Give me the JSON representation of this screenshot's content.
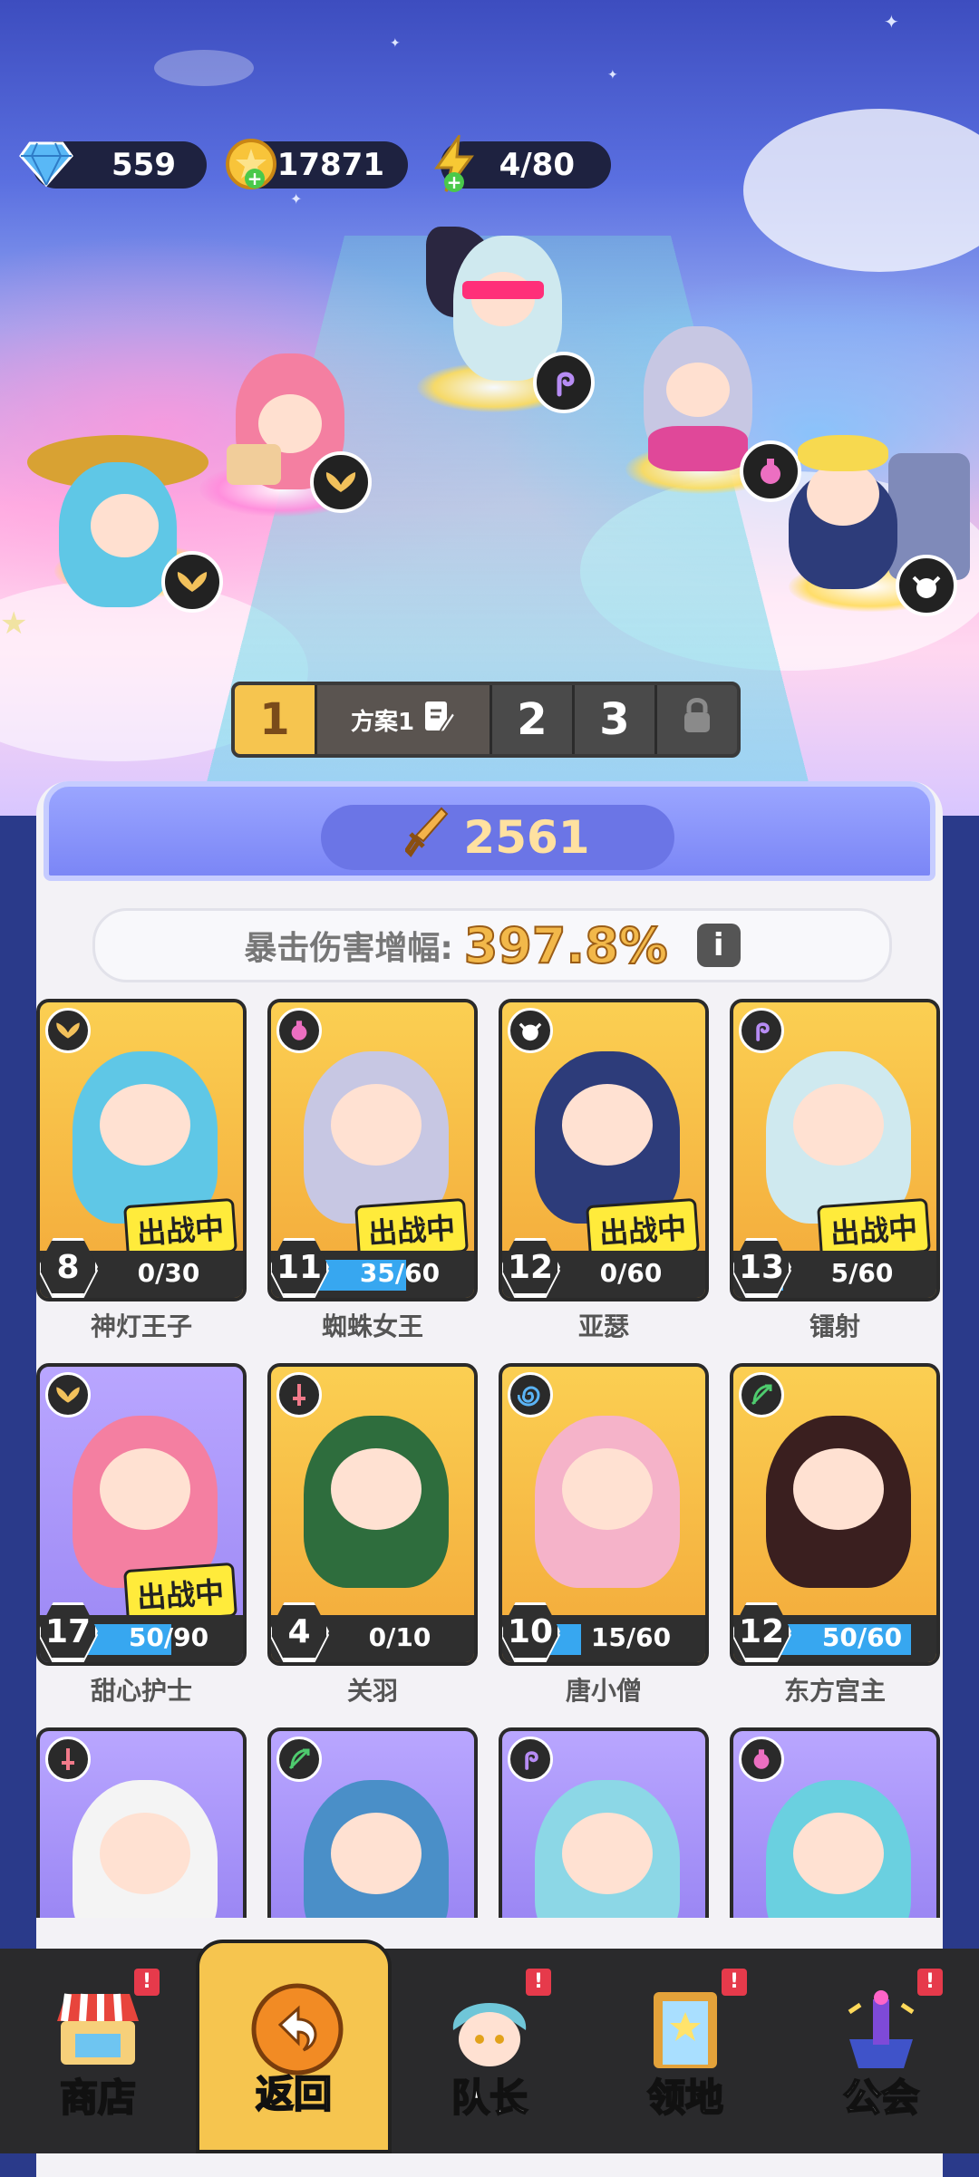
{
  "resources": {
    "diamonds": "559",
    "coins": "17871",
    "energy": "4/80"
  },
  "formation": {
    "tabs": [
      "1",
      "方案1",
      "2",
      "3"
    ],
    "active_tab": "1"
  },
  "power": "2561",
  "crit": {
    "label": "暴击伤害增幅:",
    "value": "397.8%",
    "info_icon": "i"
  },
  "heroes": [
    {
      "name": "神灯王子",
      "level": "8",
      "progress": "0/30",
      "fraction": 0.0,
      "deployed": true,
      "class_icon": "wings-icon",
      "rarity": "gold"
    },
    {
      "name": "蜘蛛女王",
      "level": "11",
      "progress": "35/60",
      "fraction": 0.58,
      "deployed": true,
      "class_icon": "potion-icon",
      "rarity": "gold"
    },
    {
      "name": "亚瑟",
      "level": "12",
      "progress": "0/60",
      "fraction": 0.0,
      "deployed": true,
      "class_icon": "cow-icon",
      "rarity": "gold"
    },
    {
      "name": "镭射",
      "level": "13",
      "progress": "5/60",
      "fraction": 0.08,
      "deployed": true,
      "class_icon": "hook-icon",
      "rarity": "gold"
    },
    {
      "name": "甜心护士",
      "level": "17",
      "progress": "50/90",
      "fraction": 0.56,
      "deployed": true,
      "class_icon": "wings-icon",
      "rarity": "purple"
    },
    {
      "name": "关羽",
      "level": "4",
      "progress": "0/10",
      "fraction": 0.0,
      "deployed": false,
      "class_icon": "sword-icon",
      "rarity": "gold"
    },
    {
      "name": "唐小僧",
      "level": "10",
      "progress": "15/60",
      "fraction": 0.25,
      "deployed": false,
      "class_icon": "spiral-icon",
      "rarity": "gold"
    },
    {
      "name": "东方宫主",
      "level": "12",
      "progress": "50/60",
      "fraction": 0.83,
      "deployed": false,
      "class_icon": "bow-icon",
      "rarity": "gold"
    },
    {
      "name": "",
      "level": "",
      "progress": "",
      "fraction": 0,
      "deployed": false,
      "class_icon": "sword-icon",
      "rarity": "purple"
    },
    {
      "name": "",
      "level": "",
      "progress": "",
      "fraction": 0,
      "deployed": false,
      "class_icon": "bow-icon",
      "rarity": "purple"
    },
    {
      "name": "",
      "level": "",
      "progress": "",
      "fraction": 0,
      "deployed": false,
      "class_icon": "hook-icon",
      "rarity": "purple"
    },
    {
      "name": "",
      "level": "",
      "progress": "",
      "fraction": 0,
      "deployed": false,
      "class_icon": "potion-icon",
      "rarity": "purple"
    }
  ],
  "deployed_label": "出战中",
  "nav": [
    {
      "label": "商店",
      "alert": "!",
      "icon": "shop-icon"
    },
    {
      "label": "返回",
      "alert": "",
      "icon": "return-icon"
    },
    {
      "label": "队长",
      "alert": "!",
      "icon": "captain-icon"
    },
    {
      "label": "领地",
      "alert": "!",
      "icon": "territory-icon"
    },
    {
      "label": "公会",
      "alert": "!",
      "icon": "guild-icon"
    }
  ],
  "colors": {
    "gold": "#f6c54f",
    "purple": "#9b87f4",
    "bar": "#37a7f0"
  }
}
